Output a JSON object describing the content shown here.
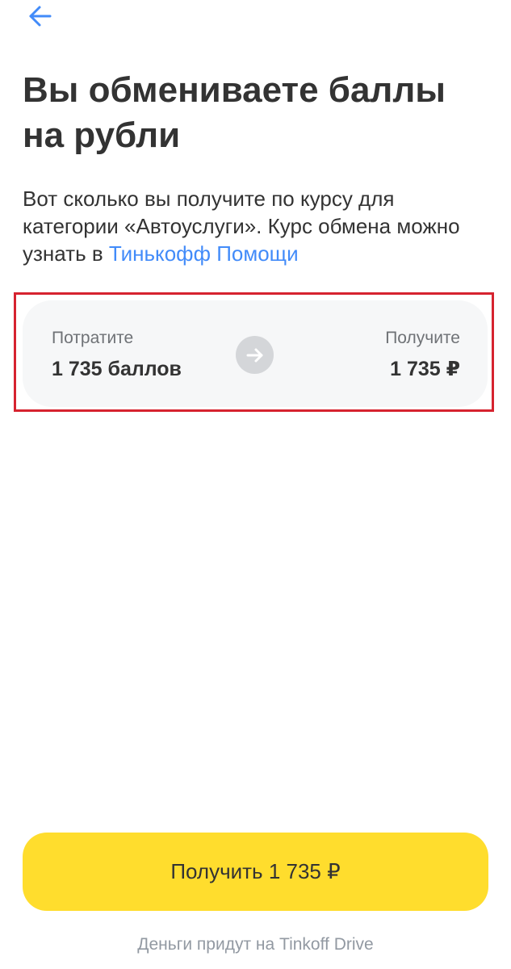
{
  "header": {
    "back_icon": "arrow-left-icon",
    "accent_color": "#428bf9"
  },
  "title": "Вы обмениваете баллы на рубли",
  "description": {
    "text": "Вот сколько вы получите по курсу для категории «Автоуслуги». Курс обмена можно узнать в ",
    "link_text": "Тинькофф Помощи"
  },
  "exchange": {
    "spend_label": "Потратите",
    "spend_value": "1 735 баллов",
    "receive_label": "Получите",
    "receive_value": "1 735 ₽",
    "arrow_icon": "arrow-right-icon",
    "highlight_color": "#d6232f"
  },
  "action": {
    "button_label": "Получить 1 735 ₽",
    "button_color": "#ffdd2d"
  },
  "footer": {
    "note": "Деньги придут на Tinkoff Drive"
  }
}
